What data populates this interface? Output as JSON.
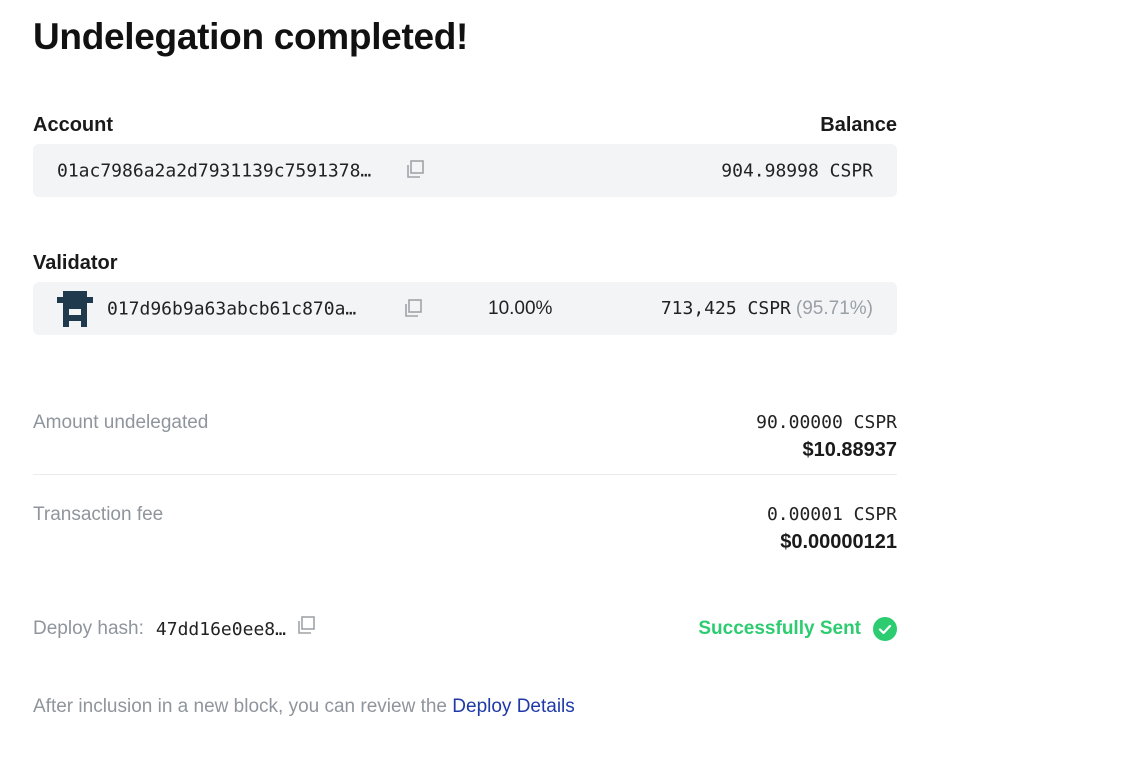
{
  "title": "Undelegation completed!",
  "account": {
    "label": "Account",
    "balance_label": "Balance",
    "address": "01ac7986a2a2d7931139c7591378…",
    "balance": "904.98998 CSPR"
  },
  "validator": {
    "label": "Validator",
    "address": "017d96b9a63abcb61c870a…",
    "fee": "10.00%",
    "stake": "713,425 CSPR",
    "stake_share": "(95.71%)"
  },
  "amount": {
    "label": "Amount undelegated",
    "cspr": "90.00000 CSPR",
    "usd": "$10.88937"
  },
  "fee": {
    "label": "Transaction fee",
    "cspr": "0.00001 CSPR",
    "usd": "$0.00000121"
  },
  "deploy": {
    "label": "Deploy hash:",
    "hash": "47dd16e0ee8…",
    "status": "Successfully Sent"
  },
  "footer": {
    "text": "After inclusion in a new block, you can review the ",
    "link": "Deploy Details"
  },
  "colors": {
    "success": "#2ecc71",
    "link": "#1f3aa8",
    "avatar": "#1f3a4d"
  },
  "icons": [
    "copy-icon",
    "check-circle-icon",
    "validator-avatar"
  ]
}
